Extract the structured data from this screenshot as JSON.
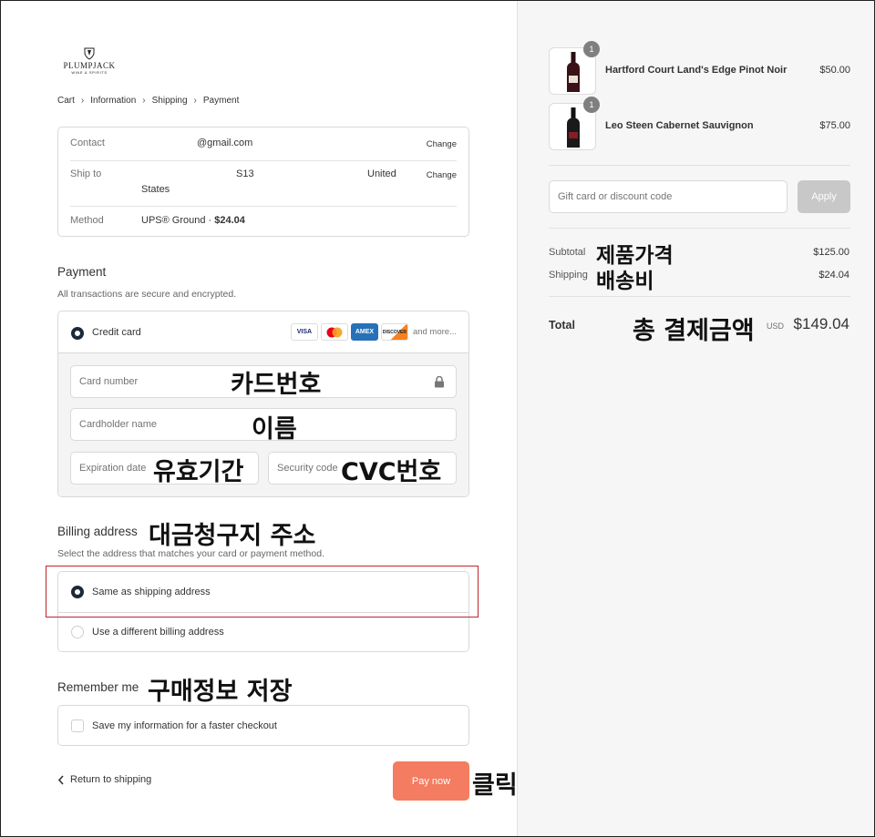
{
  "brand": {
    "name": "PLUMPJACK",
    "sub": "WINE & SPIRITS"
  },
  "breadcrumbs": [
    {
      "label": "Cart"
    },
    {
      "label": "Information"
    },
    {
      "label": "Shipping"
    },
    {
      "label": "Payment"
    }
  ],
  "review": {
    "contact_label": "Contact",
    "contact_value": "@gmail.com",
    "ship_label": "Ship to",
    "ship_value_1": "S13",
    "ship_value_2": "United",
    "ship_value_3": "States",
    "method_label": "Method",
    "method_value": "UPS® Ground · ",
    "method_price": "$24.04",
    "change": "Change"
  },
  "payment": {
    "title": "Payment",
    "subtitle": "All transactions are secure and encrypted.",
    "credit_card_label": "Credit card",
    "card_brands": [
      "VISA",
      "",
      "AMEX",
      "DISCOVER"
    ],
    "more": "and more...",
    "card_number_placeholder": "Card number",
    "cardholder_placeholder": "Cardholder name",
    "expiry_placeholder": "Expiration date",
    "security_placeholder": "Security code"
  },
  "billing": {
    "title": "Billing address",
    "subtitle": "Select the address that matches your card or payment method.",
    "same_label": "Same as shipping address",
    "different_label": "Use a different billing address"
  },
  "remember": {
    "title": "Remember me",
    "save_label": "Save my information for a faster checkout"
  },
  "actions": {
    "return_label": "Return to shipping",
    "pay_label": "Pay now"
  },
  "annotations": {
    "card_number": "카드번호",
    "name": "이름",
    "expiry": "유효기간",
    "cvc": "CVC번호",
    "billing": "대금청구지 주소",
    "remember": "구매정보 저장",
    "click": "클릭",
    "subtotal": "제품가격",
    "shipping": "배송비",
    "total": "총 결제금액"
  },
  "cart": {
    "items": [
      {
        "name": "Hartford Court Land's Edge Pinot Noir",
        "price": "$50.00",
        "qty": "1"
      },
      {
        "name": "Leo Steen Cabernet Sauvignon",
        "price": "$75.00",
        "qty": "1"
      }
    ],
    "gift_placeholder": "Gift card or discount code",
    "apply_label": "Apply",
    "subtotal_label": "Subtotal",
    "subtotal_value": "$125.00",
    "shipping_label": "Shipping",
    "shipping_value": "$24.04",
    "total_label": "Total",
    "currency": "USD",
    "total_value": "$149.04"
  },
  "colors": {
    "accent": "#f47c61",
    "highlight": "#c0242b",
    "radio_selected": "#1b2a3a"
  }
}
